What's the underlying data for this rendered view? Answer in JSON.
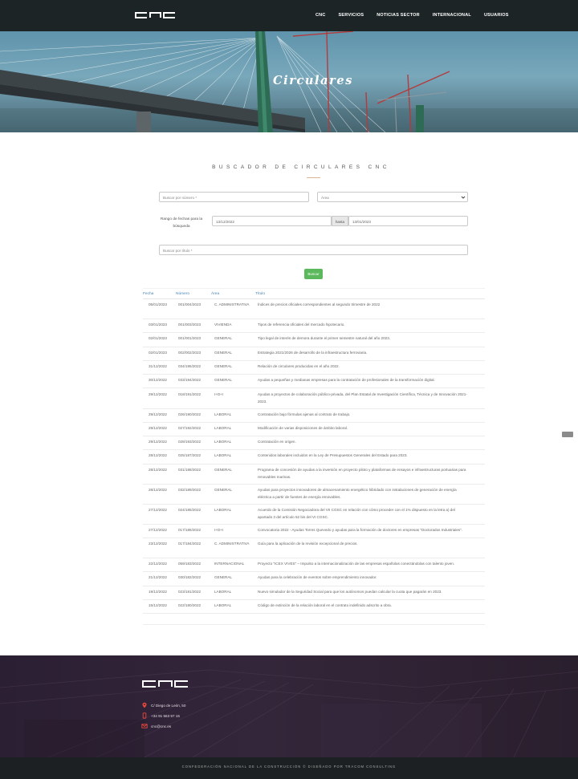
{
  "nav": {
    "logo_text": "CNC",
    "items": [
      "CNC",
      "SERVICIOS",
      "NOTICIAS SECTOR",
      "INTERNACIONAL",
      "USUARIOS"
    ]
  },
  "hero": {
    "title": "Circulares"
  },
  "search": {
    "heading": "BUSCADOR DE CIRCULARES CNC",
    "numero_placeholder": "Buscar por número *",
    "area_selected": "Área",
    "range_label": "Rango de fechas para la búsqueda",
    "date_from": "13/12/2022",
    "hasta_label": "hasta",
    "date_to": "13/01/2023",
    "titulo_placeholder": "Buscar por título *",
    "button_label": "Buscar"
  },
  "table": {
    "headers": {
      "fecha": "Fecha",
      "numero": "Número",
      "area": "Área",
      "titulo": "Título"
    },
    "rows": [
      {
        "fecha": "05/01/2023",
        "numero": "001/004/2023",
        "area": "C. ADMINISTRATIVA",
        "titulo": "Índices de precios oficiales correspondientes al segundo trimestre de 2022"
      },
      {
        "fecha": "03/01/2023",
        "numero": "001/003/2023",
        "area": "VIVIENDA",
        "titulo": "Tipos de referencia oficiales del mercado hipotecario."
      },
      {
        "fecha": "02/01/2023",
        "numero": "001/001/2023",
        "area": "GENERAL",
        "titulo": "Tipo legal de interés de demora durante el primer semestre natural del año 2023."
      },
      {
        "fecha": "02/01/2023",
        "numero": "002/002/2023",
        "area": "GENERAL",
        "titulo": "Estrategia 2021/2026 de desarrollo de la infraestructura ferroviaria."
      },
      {
        "fecha": "31/12/2022",
        "numero": "034/195/2022",
        "area": "GENERAL",
        "titulo": "Relación de circulares producidas en el año 2022."
      },
      {
        "fecha": "30/12/2022",
        "numero": "033/194/2022",
        "area": "GENERAL",
        "titulo": "Ayudas a pequeñas y medianas empresas para la contratación de profesionales de la transformación digital."
      },
      {
        "fecha": "29/12/2022",
        "numero": "018/191/2022",
        "area": "I+D+I",
        "titulo": "Ayudas a proyectos de colaboración público-privada, del Plan Estatal de Investigación Científica, Técnica y de Innovación 2021-2023."
      },
      {
        "fecha": "29/12/2022",
        "numero": "026/190/2022",
        "area": "LABORAL",
        "titulo": "Contratación bajo fórmulas ajenas al contrato de trabajo."
      },
      {
        "fecha": "29/12/2022",
        "numero": "027/192/2022",
        "area": "LABORAL",
        "titulo": "Modificación de varias disposiciones de ámbito laboral."
      },
      {
        "fecha": "29/12/2022",
        "numero": "028/193/2022",
        "area": "LABORAL",
        "titulo": "Contratación en origen."
      },
      {
        "fecha": "28/12/2022",
        "numero": "025/187/2022",
        "area": "LABORAL",
        "titulo": "Contenidos laborales incluidos en la Ley de Presupuestos Generales del Estado para 2023."
      },
      {
        "fecha": "28/12/2022",
        "numero": "031/188/2022",
        "area": "GENERAL",
        "titulo": "Programa de concesión de ayudas a la inversión en proyecto piloto y plataformas de ensayos e infraestructuras portuarias para renovables marinas."
      },
      {
        "fecha": "28/12/2022",
        "numero": "032/189/2022",
        "area": "GENERAL",
        "titulo": "Ayudas para proyectos innovadores de almacenamiento energético hibridado con instalaciones de generación de energía eléctrica a partir de fuentes de energía renovables."
      },
      {
        "fecha": "27/12/2022",
        "numero": "024/185/2022",
        "area": "LABORAL",
        "titulo": "Acuerdo de la Comisión Negociadora del VII CGSC en relación con cómo proceder con el 1% dispuesto en la letra a) del apartado 3 del artículo 52 bis del VI CGSC."
      },
      {
        "fecha": "27/12/2022",
        "numero": "017/186/2022",
        "area": "I+D+I",
        "titulo": "Convocatoria 2022 - Ayudas Torres Quevedo y ayudas para la formación de doctores en empresas \"Doctorados Industriales\"."
      },
      {
        "fecha": "23/12/2022",
        "numero": "017/184/2022",
        "area": "C. ADMINISTRATIVA",
        "titulo": "Guía para la aplicación de la revisión excepcional de precios."
      },
      {
        "fecha": "22/12/2022",
        "numero": "059/183/2022",
        "area": "INTERNACIONAL",
        "titulo": "Proyecto \"ICEX VIVES\" – Impulso a la internacionalización de las empresas españolas conectándolas con talento joven."
      },
      {
        "fecha": "21/12/2022",
        "numero": "030/182/2022",
        "area": "GENERAL",
        "titulo": "Ayudas para la celebración de eventos sobre emprendimiento innovador."
      },
      {
        "fecha": "19/12/2022",
        "numero": "023/181/2022",
        "area": "LABORAL",
        "titulo": "Nuevo simulador de la Seguridad Social para que los autónomos puedan calcular la cuota que pagarán en 2023."
      },
      {
        "fecha": "15/12/2022",
        "numero": "022/180/2022",
        "area": "LABORAL",
        "titulo": "Código de extinción de la relación laboral en el contrato indefinido adscrito a obra."
      }
    ]
  },
  "footer": {
    "logo_text": "CNC",
    "address": "C/ Diego de León, 50",
    "phone": "+34 91 563 97 15",
    "email": "cnc@cnc.es",
    "copyright": "CONFEDERACIÓN NACIONAL DE LA CONSTRUCCIÓN © DISEÑADO POR TRACOM CONSULTING"
  },
  "colors": {
    "nav_bg": "#1c2426",
    "link_blue": "#4a86b5",
    "button_green": "#5cb85c",
    "footer_bg": "#2b1f33",
    "accent_rule": "#e0b48f"
  },
  "icons": [
    "chevron-down-icon",
    "map-pin-icon",
    "phone-icon",
    "mail-icon"
  ]
}
